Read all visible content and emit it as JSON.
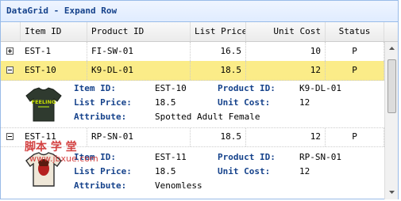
{
  "panel": {
    "title": "DataGrid - Expand Row"
  },
  "columns": [
    "Item ID",
    "Product ID",
    "List Price",
    "Unit Cost",
    "Status"
  ],
  "rows": [
    {
      "item_id": "EST-1",
      "product_id": "FI-SW-01",
      "list_price": "16.5",
      "unit_cost": "10",
      "status": "P",
      "expanded": false
    },
    {
      "item_id": "EST-10",
      "product_id": "K9-DL-01",
      "list_price": "18.5",
      "unit_cost": "12",
      "status": "P",
      "expanded": true
    },
    {
      "item_id": "EST-11",
      "product_id": "RP-SN-01",
      "list_price": "18.5",
      "unit_cost": "12",
      "status": "P",
      "expanded": true
    }
  ],
  "details": [
    {
      "item_id_label": "Item ID:",
      "item_id": "EST-10",
      "product_id_label": "Product ID:",
      "product_id": "K9-DL-01",
      "list_price_label": "List Price:",
      "list_price": "18.5",
      "unit_cost_label": "Unit Cost:",
      "unit_cost": "12",
      "attribute_label": "Attribute:",
      "attribute": "Spotted Adult Female",
      "shirt_text": "FEELING"
    },
    {
      "item_id_label": "Item ID:",
      "item_id": "EST-11",
      "product_id_label": "Product ID:",
      "product_id": "RP-SN-01",
      "list_price_label": "List Price:",
      "list_price": "18.5",
      "unit_cost_label": "Unit Cost:",
      "unit_cost": "12",
      "attribute_label": "Attribute:",
      "attribute": "Venomless"
    }
  ],
  "watermark": {
    "text": "脚本 学 堂",
    "url": "www.jbxue.com"
  },
  "colors": {
    "header_text": "#15428b",
    "selected_row": "#fbec88",
    "border": "#99bbe8"
  }
}
